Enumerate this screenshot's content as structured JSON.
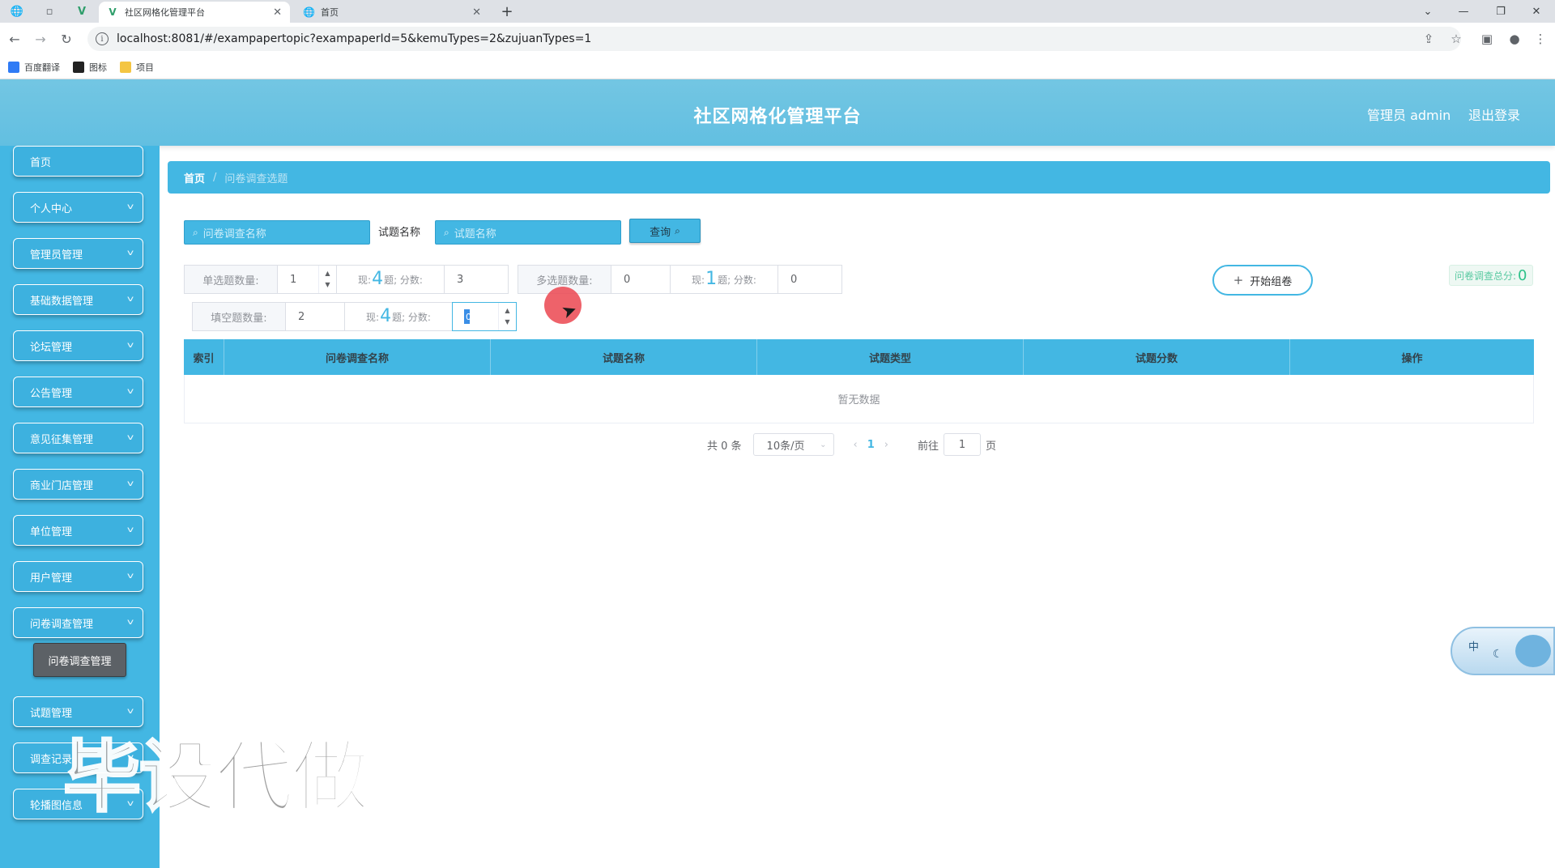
{
  "browser": {
    "tabs": [
      {
        "title": "社区网格化管理平台",
        "active": true
      },
      {
        "title": "首页",
        "active": false
      }
    ],
    "url": "localhost:8081/#/exampapertopic?exampaperId=5&kemuTypes=2&zujuanTypes=1",
    "bookmarks": [
      {
        "label": "百度翻译",
        "color": "#2f7bf5"
      },
      {
        "label": "图标",
        "color": "#222222"
      },
      {
        "label": "项目",
        "color": "#f4c542"
      }
    ]
  },
  "header": {
    "title": "社区网格化管理平台",
    "user": "管理员 admin",
    "logout": "退出登录"
  },
  "sidebar": {
    "items": [
      {
        "label": "首页",
        "has_chevron": false
      },
      {
        "label": "个人中心",
        "has_chevron": true
      },
      {
        "label": "管理员管理",
        "has_chevron": true
      },
      {
        "label": "基础数据管理",
        "has_chevron": true
      },
      {
        "label": "论坛管理",
        "has_chevron": true
      },
      {
        "label": "公告管理",
        "has_chevron": true
      },
      {
        "label": "意见征集管理",
        "has_chevron": true
      },
      {
        "label": "商业门店管理",
        "has_chevron": true
      },
      {
        "label": "单位管理",
        "has_chevron": true
      },
      {
        "label": "用户管理",
        "has_chevron": true
      },
      {
        "label": "问卷调查管理",
        "has_chevron": true
      },
      {
        "label": "试题管理",
        "has_chevron": true
      },
      {
        "label": "调查记录",
        "has_chevron": true
      },
      {
        "label": "轮播图信息",
        "has_chevron": true
      }
    ],
    "submenu": {
      "label": "问卷调查管理"
    }
  },
  "breadcrumb": {
    "home": "首页",
    "separator": "/",
    "current": "问卷调查选题"
  },
  "search": {
    "survey_name_placeholder": "问卷调查名称",
    "question_label": "试题名称",
    "question_placeholder": "试题名称",
    "query_button": "查询"
  },
  "config": {
    "single": {
      "label": "单选题数量:",
      "count": "1",
      "now_prefix": "现:",
      "now_value": "4",
      "now_suffix": "题;  分数:",
      "score": "3"
    },
    "multi": {
      "label": "多选题数量:",
      "count": "0",
      "now_prefix": "现:",
      "now_value": "1",
      "now_suffix": "题;  分数:",
      "score": "0"
    },
    "fill": {
      "label": "填空题数量:",
      "count": "2",
      "now_prefix": "现:",
      "now_value": "4",
      "now_suffix": "题;  分数:",
      "score": "0"
    }
  },
  "actions": {
    "start_button": "开始组卷",
    "total_label": "问卷调查总分:",
    "total_value": "0"
  },
  "table": {
    "columns": [
      "索引",
      "问卷调查名称",
      "试题名称",
      "试题类型",
      "试题分数",
      "操作"
    ],
    "rows": [],
    "empty_text": "暂无数据"
  },
  "pagination": {
    "total": "共 0 条",
    "page_size": "10条/页",
    "prev": "‹",
    "current_page": "1",
    "next": "›",
    "goto_label": "前往",
    "goto_value": "1",
    "goto_suffix": "页"
  },
  "watermark": "毕设代做",
  "ime": {
    "label": "中"
  },
  "colors": {
    "primary": "#43b7e3",
    "header": "#6cc4e2",
    "cursor_highlight": "#eb4650"
  }
}
